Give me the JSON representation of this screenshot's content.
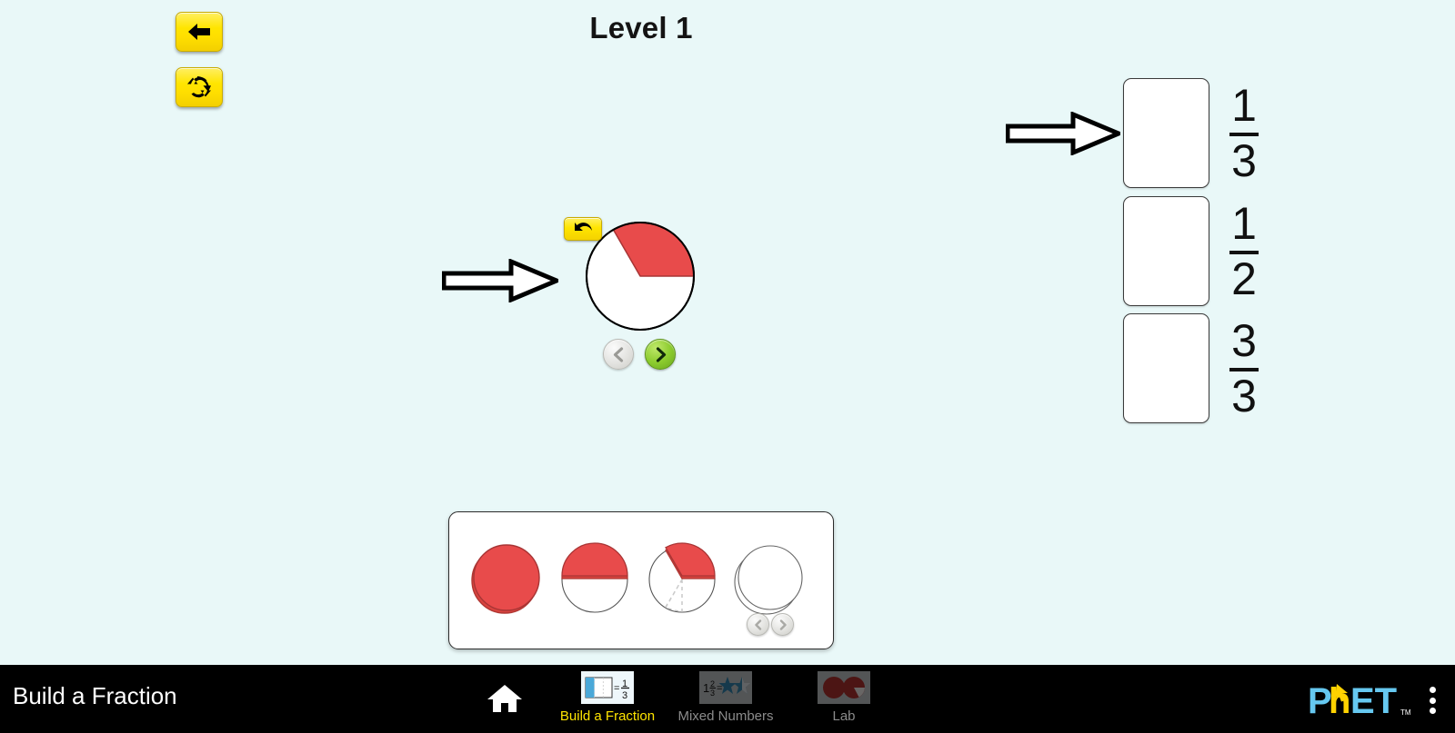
{
  "background_color": "#e9f8f8",
  "accent_red": "#e84b4b",
  "accent_yellow": "#ffe500",
  "header": {
    "level_title": "Level 1"
  },
  "controls": {
    "back_button": {
      "label": "",
      "icon": "back-arrow-icon",
      "tooltip": "Back"
    },
    "reset_button": {
      "label": "",
      "icon": "refresh-icon",
      "tooltip": "Reset"
    },
    "undo_button": {
      "label": "",
      "icon": "undo-arrow-icon",
      "tooltip": "Undo"
    }
  },
  "working_piece": {
    "shape": "pie",
    "denominator": 3,
    "filled_segments": 1,
    "fill_color": "#e84b4b",
    "start_angle_deg": 0,
    "end_angle_deg": 120,
    "prev_button": {
      "icon": "chevron-left-icon",
      "enabled": false
    },
    "next_button": {
      "icon": "chevron-right-icon",
      "enabled": true
    }
  },
  "targets": [
    {
      "numerator": "1",
      "denominator": "3",
      "filled": false,
      "has_pointer": true
    },
    {
      "numerator": "1",
      "denominator": "2",
      "filled": false,
      "has_pointer": false
    },
    {
      "numerator": "3",
      "denominator": "3",
      "filled": false,
      "has_pointer": false
    }
  ],
  "toolbox": {
    "pieces": [
      {
        "name": "whole-circle",
        "denominator": 1,
        "filled": 1,
        "label": "1/1"
      },
      {
        "name": "half-circle",
        "denominator": 2,
        "filled": 1,
        "label": "1/2"
      },
      {
        "name": "third-circle",
        "denominator": 3,
        "filled": 1,
        "label": "1/3"
      },
      {
        "name": "empty-circle-stack",
        "denominator": 1,
        "filled": 0,
        "label": "empty"
      }
    ],
    "prev_button": {
      "icon": "chevron-left-icon",
      "enabled": false
    },
    "next_button": {
      "icon": "chevron-right-icon",
      "enabled": false
    }
  },
  "navbar": {
    "sim_title": "Build a Fraction",
    "home_icon": "home-icon",
    "screens": [
      {
        "label": "Build a Fraction",
        "icon": "build-a-fraction-thumb",
        "selected": true
      },
      {
        "label": "Mixed Numbers",
        "icon": "mixed-numbers-thumb",
        "selected": false
      },
      {
        "label": "Lab",
        "icon": "lab-thumb",
        "selected": false
      }
    ],
    "logo": {
      "text_part_1": "P",
      "text_part_2": "h",
      "text_part_3": "ET",
      "trademark": "TM",
      "color_blue": "#66c8f0",
      "color_yellow": "#ffd200"
    },
    "menu_icon": "kebab-menu-icon"
  }
}
